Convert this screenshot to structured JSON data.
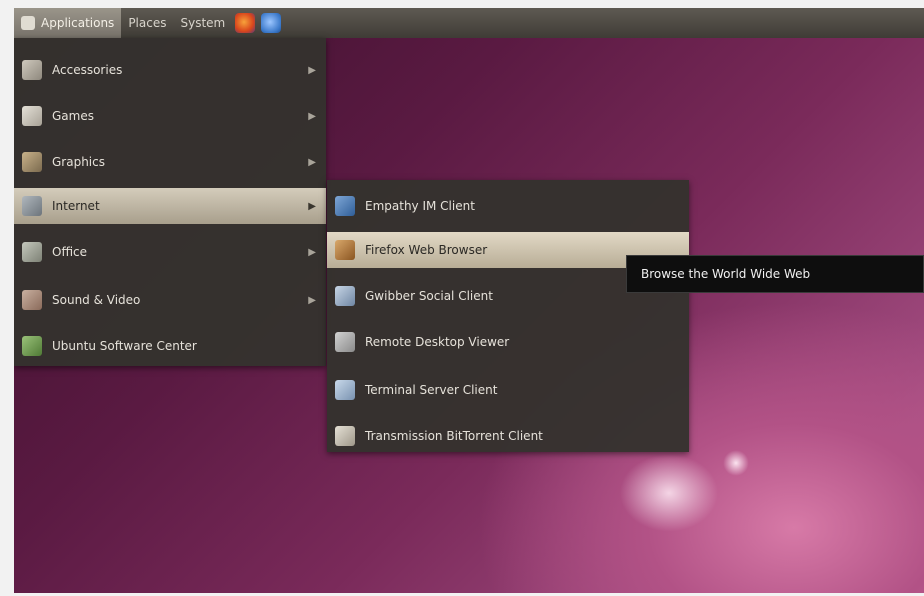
{
  "topbar": {
    "items": [
      {
        "label": "Applications"
      },
      {
        "label": "Places"
      },
      {
        "label": "System"
      }
    ],
    "icons": [
      "firefox-icon",
      "help-icon"
    ]
  },
  "main_menu": {
    "items": [
      {
        "label": "Accessories",
        "icon": "accessories-icon",
        "has_submenu": true
      },
      {
        "label": "Games",
        "icon": "games-icon",
        "has_submenu": true
      },
      {
        "label": "Graphics",
        "icon": "graphics-icon",
        "has_submenu": true
      },
      {
        "label": "Internet",
        "icon": "internet-icon",
        "has_submenu": true
      },
      {
        "label": "Office",
        "icon": "office-icon",
        "has_submenu": true
      },
      {
        "label": "Sound & Video",
        "icon": "sound-video-icon",
        "has_submenu": true
      },
      {
        "label": "Ubuntu Software Center",
        "icon": "software-center-icon",
        "has_submenu": false
      }
    ],
    "highlighted": "Internet"
  },
  "sub_menu": {
    "items": [
      {
        "label": "Empathy IM Client",
        "icon": "empathy-icon"
      },
      {
        "label": "Firefox Web Browser",
        "icon": "firefox-icon"
      },
      {
        "label": "Gwibber Social Client",
        "icon": "gwibber-icon"
      },
      {
        "label": "Remote Desktop Viewer",
        "icon": "remote-desktop-icon"
      },
      {
        "label": "Terminal Server Client",
        "icon": "terminal-server-icon"
      },
      {
        "label": "Transmission BitTorrent Client",
        "icon": "transmission-icon"
      }
    ],
    "highlighted": "Firefox Web Browser"
  },
  "tooltip": {
    "text": "Browse the World Wide Web"
  }
}
